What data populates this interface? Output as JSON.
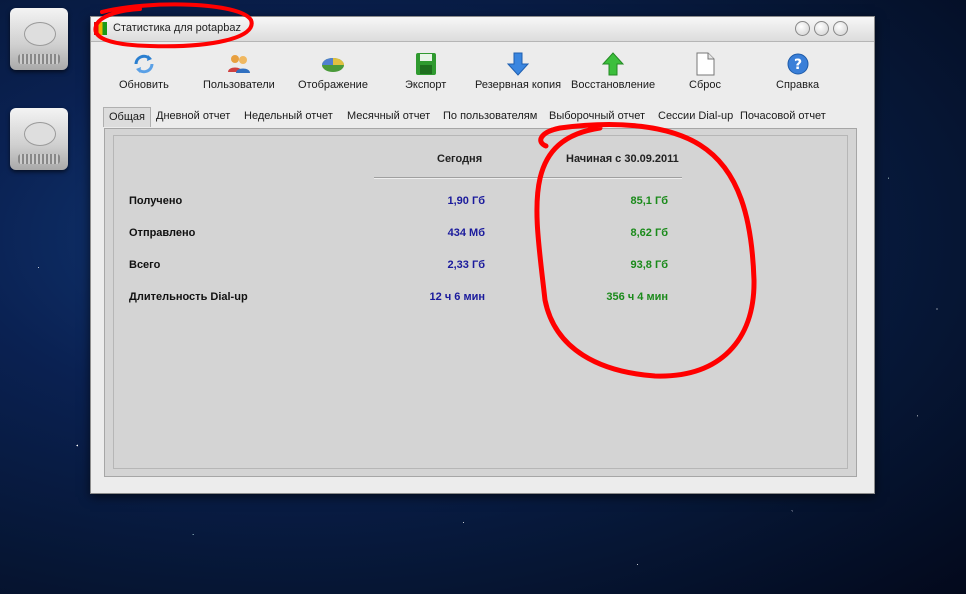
{
  "window": {
    "title": "Статистика для potapbaz"
  },
  "toolbar": {
    "refresh_label": "Обновить",
    "users_label": "Пользователи",
    "display_label": "Отображение",
    "export_label": "Экспорт",
    "backup_label": "Резервная копия",
    "restore_label": "Восстановление",
    "reset_label": "Сброс",
    "help_label": "Справка"
  },
  "tabs": [
    {
      "label": "Общая",
      "active": true
    },
    {
      "label": "Дневной отчет"
    },
    {
      "label": "Недельный отчет"
    },
    {
      "label": "Месячный отчет"
    },
    {
      "label": "По пользователям"
    },
    {
      "label": "Выборочный отчет"
    },
    {
      "label": "Сессии Dial-up"
    },
    {
      "label": "Почасовой отчет"
    }
  ],
  "stats": {
    "col_today": "Сегодня",
    "col_since": "Начиная с 30.09.2011",
    "rows": [
      {
        "label": "Получено",
        "today": "1,90 Гб",
        "since": "85,1 Гб"
      },
      {
        "label": "Отправлено",
        "today": "434 Мб",
        "since": "8,62 Гб"
      },
      {
        "label": "Всего",
        "today": "2,33 Гб",
        "since": "93,8 Гб"
      },
      {
        "label": "Длительность Dial-up",
        "today": "12 ч 6 мин",
        "since": "356 ч 4 мин"
      }
    ]
  },
  "colors": {
    "today_value": "#1a1a9c",
    "since_value": "#1a8a1a",
    "annotation": "#ff0000"
  }
}
